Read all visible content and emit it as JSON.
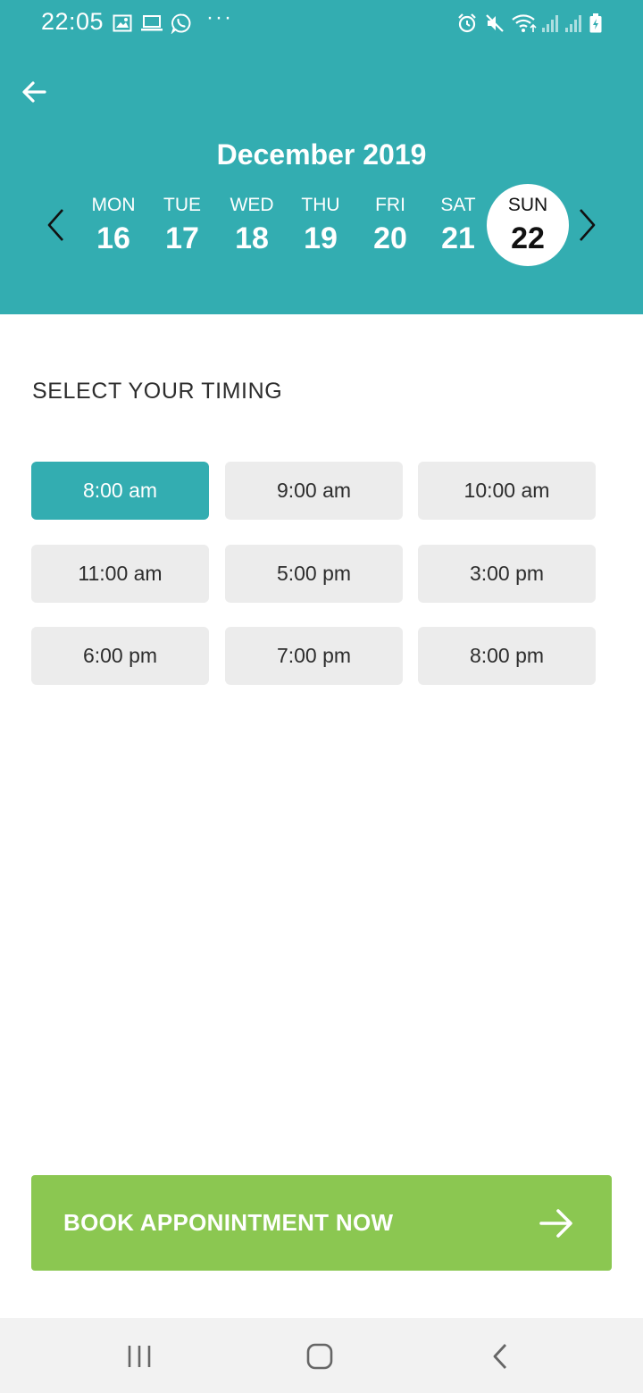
{
  "status_bar": {
    "time": "22:05",
    "left_icons": [
      "image-icon",
      "laptop-icon",
      "whatsapp-icon"
    ],
    "more": "···",
    "right_icons": [
      "alarm-icon",
      "mute-icon",
      "wifi-icon",
      "signal-icon",
      "signal-icon",
      "battery-icon"
    ]
  },
  "header": {
    "back_icon": "arrow-left-icon",
    "month": "December 2019",
    "prev_icon": "chevron-left-icon",
    "next_icon": "chevron-right-icon",
    "days": [
      {
        "name": "MON",
        "num": "16"
      },
      {
        "name": "TUE",
        "num": "17"
      },
      {
        "name": "WED",
        "num": "18"
      },
      {
        "name": "THU",
        "num": "19"
      },
      {
        "name": "FRI",
        "num": "20"
      },
      {
        "name": "SAT",
        "num": "21"
      },
      {
        "name": "SUN",
        "num": "22"
      }
    ],
    "selected_day": "SUN 22"
  },
  "timing": {
    "title": "SELECT YOUR TIMING",
    "slots": [
      "8:00 am",
      "9:00 am",
      "10:00 am",
      "11:00 am",
      "5:00 pm",
      "3:00 pm",
      "6:00 pm",
      "7:00 pm",
      "8:00 pm"
    ],
    "selected": "8:00 am"
  },
  "book_button": {
    "label": "BOOK APPONINTMENT NOW",
    "icon": "arrow-right-icon"
  },
  "nav_bar": {
    "buttons": [
      "recent-apps-icon",
      "home-icon",
      "back-icon"
    ]
  },
  "colors": {
    "primary": "#33adb1",
    "accent_green": "#8bc751",
    "slot_bg": "#ececec"
  }
}
